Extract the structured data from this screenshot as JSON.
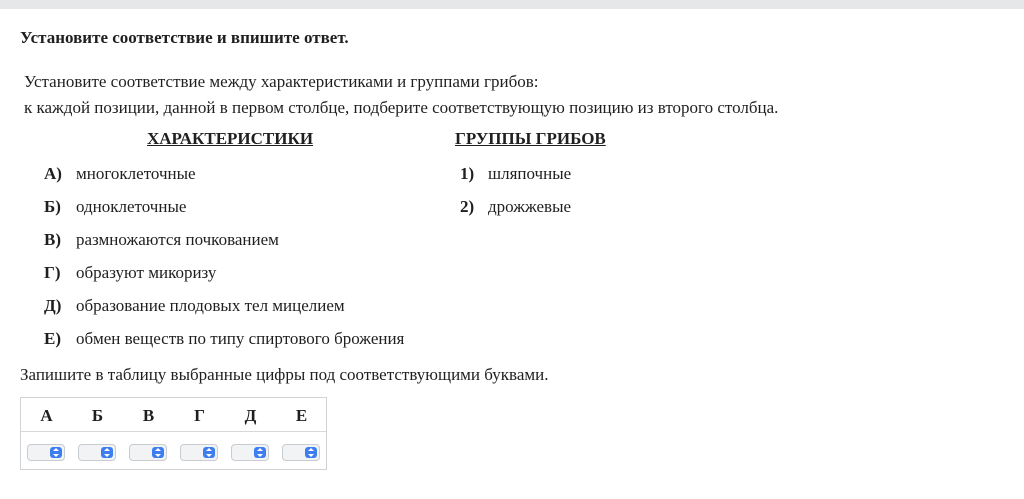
{
  "task": {
    "title": "Установите соответствие и впишите ответ.",
    "intro_line1": "Установите соответствие между характеристиками и группами грибов:",
    "intro_line2": "к каждой позиции, данной в первом столбце, подберите соответствующую позицию из второго столбца."
  },
  "columns": {
    "left_header": "ХАРАКТЕРИСТИКИ",
    "right_header": "ГРУППЫ ГРИБОВ"
  },
  "characteristics": [
    {
      "key": "А)",
      "text": "многоклеточные"
    },
    {
      "key": "Б)",
      "text": "одноклеточные"
    },
    {
      "key": "В)",
      "text": "размножаются почкованием"
    },
    {
      "key": "Г)",
      "text": "образуют микоризу"
    },
    {
      "key": "Д)",
      "text": "образование плодовых тел мицелием"
    },
    {
      "key": "Е)",
      "text": "обмен веществ по типу спиртового брожения"
    }
  ],
  "groups": [
    {
      "key": "1)",
      "text": "шляпочные"
    },
    {
      "key": "2)",
      "text": "дрожжевые"
    }
  ],
  "instruction": "Запишите в таблицу выбранные цифры под соответствующими буквами.",
  "answer_table": {
    "letters": [
      "А",
      "Б",
      "В",
      "Г",
      "Д",
      "Е"
    ],
    "selected": [
      "",
      "",
      "",
      "",
      "",
      ""
    ],
    "accent_color": "#3d7ff0",
    "control_icon": "updown-arrows-icon"
  }
}
